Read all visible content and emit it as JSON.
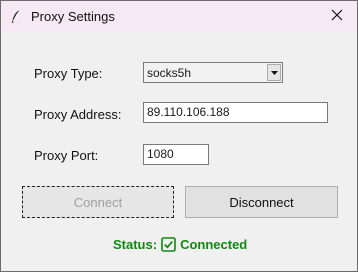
{
  "window": {
    "title": "Proxy Settings",
    "app_icon": "feather-icon",
    "close_icon": "close-icon"
  },
  "form": {
    "proxy_type_label": "Proxy Type:",
    "proxy_type_value": "socks5h",
    "proxy_address_label": "Proxy Address:",
    "proxy_address_value": "89.110.106.188",
    "proxy_port_label": "Proxy Port:",
    "proxy_port_value": "1080"
  },
  "buttons": {
    "connect_label": "Connect",
    "disconnect_label": "Disconnect"
  },
  "status": {
    "label": "Status:",
    "value": "Connected",
    "icon": "check-box-icon",
    "color": "#108a10"
  }
}
